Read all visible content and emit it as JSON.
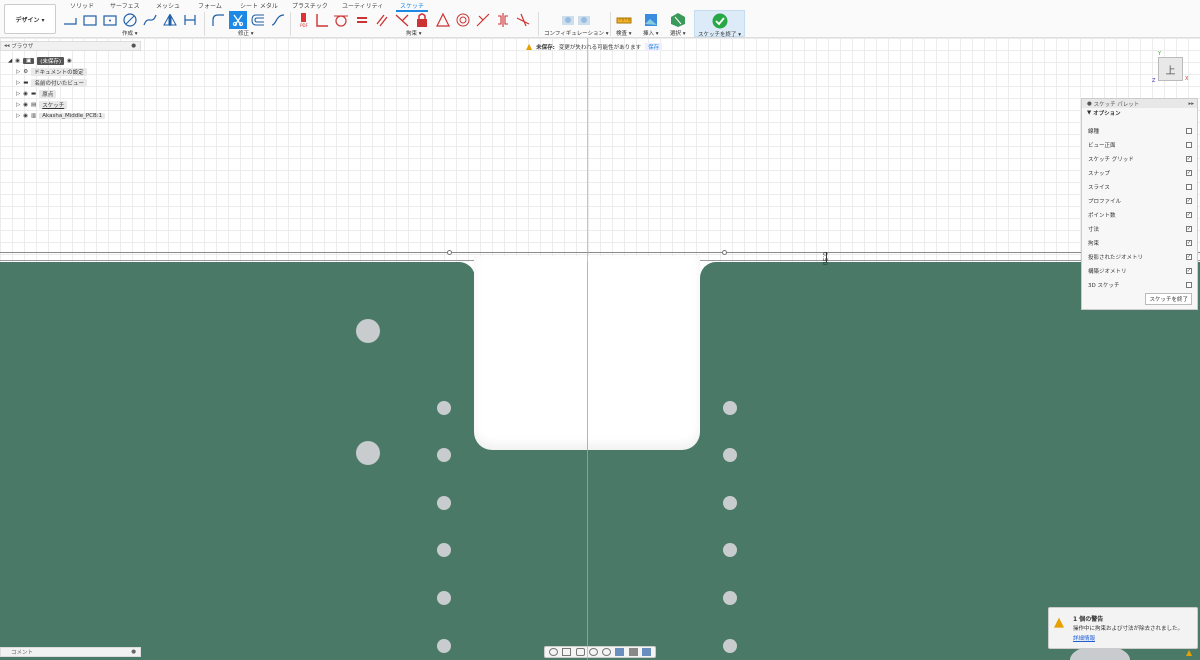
{
  "toolbar": {
    "workspace": "デザイン ▾",
    "tabs": [
      "ソリッド",
      "サーフェス",
      "メッシュ",
      "フォーム",
      "シート メタル",
      "プラスチック",
      "ユーティリティ",
      "スケッチ"
    ],
    "groups": [
      "作成 ▾",
      "修正 ▾",
      "拘束 ▾",
      "コンフィギュレーション ▾",
      "検査 ▾",
      "挿入 ▾",
      "選択 ▾",
      "スケッチを終了 ▾"
    ]
  },
  "browser": {
    "title": "ブラウザ",
    "items": [
      {
        "label": "(未保存)",
        "icon": "document-icon"
      },
      {
        "label": "ドキュメントの設定",
        "icon": "gear-icon"
      },
      {
        "label": "名前の付いたビュー",
        "icon": "folder-icon"
      },
      {
        "label": "原点",
        "icon": "folder-icon"
      },
      {
        "label": "スケッチ",
        "icon": "sketch-icon"
      },
      {
        "label": "Akasha_Middle_PCB:1",
        "icon": "component-icon"
      }
    ]
  },
  "unsaved_banner": {
    "label": "未保存:",
    "message": "変更が失われる可能性があります",
    "save": "保存"
  },
  "dimension_label": "0.50",
  "viewcube_face": "上",
  "axis_labels": {
    "y": "Y",
    "x": "X",
    "z": "Z"
  },
  "sketch_palette": {
    "title": "スケッチ パレット",
    "section": "オプション",
    "options": [
      {
        "label": "線種",
        "checked": false
      },
      {
        "label": "ビュー正面",
        "checked": false
      },
      {
        "label": "スケッチ グリッド",
        "checked": true
      },
      {
        "label": "スナップ",
        "checked": true
      },
      {
        "label": "スライス",
        "checked": false
      },
      {
        "label": "プロファイル",
        "checked": true
      },
      {
        "label": "ポイント数",
        "checked": true
      },
      {
        "label": "寸法",
        "checked": true
      },
      {
        "label": "拘束",
        "checked": true
      },
      {
        "label": "投影されたジオメトリ",
        "checked": true
      },
      {
        "label": "構築ジオメトリ",
        "checked": true
      },
      {
        "label": "3D スケッチ",
        "checked": false
      }
    ],
    "finish": "スケッチを終了"
  },
  "warning": {
    "title": "1 個の警告",
    "message": "操作中に拘束および寸法が除去されました。",
    "link": "詳細情報"
  },
  "comments": {
    "title": "コメント"
  },
  "colors": {
    "pcb": "#4a7a67",
    "accent": "#1e88e5",
    "hole": "#c9ccce"
  }
}
